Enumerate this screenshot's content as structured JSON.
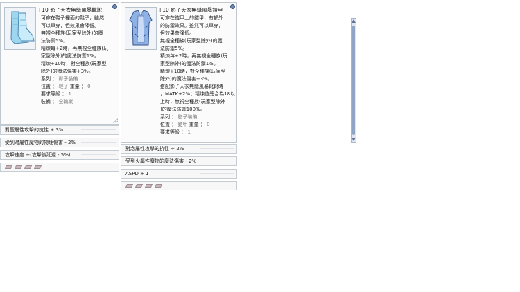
{
  "left": {
    "title": "+10 影子天衣無縫風暴靴靴",
    "image_icon": "blue-boots-icon",
    "lines": [
      "可穿在鞋子裡面的鞋子，雖然",
      "可以單穿，但效果會降低。",
      "無視全種族(玩家型除外)的魔",
      "法防禦5%。",
      "精煉每+2時，再無視全種族(玩",
      "家型除外)的魔法防禦1%。",
      "精煉+10時，對全種族(玩家型",
      "除外)的魔法傷害+3%。"
    ],
    "props": [
      {
        "label": "系列",
        "value": "影子裝備"
      },
      {
        "label": "位置",
        "value": "鞋子",
        "label2": "重量",
        "value2": "0"
      },
      {
        "label": "要求等級",
        "value": "1"
      },
      {
        "label": "裝備",
        "value": "全職業"
      }
    ],
    "bars": [
      "對聖屬性攻擊的抗性 + 3%",
      "受到暗屬性魔物的物理傷害 - 2%",
      "攻擊速度 +(攻擊後延遲 - 5%)"
    ]
  },
  "right": {
    "title": "+10 影子天衣無縫風暴鎧甲",
    "image_icon": "blue-armor-icon",
    "lines": [
      "可穿在鎧甲上的鎧甲，有額外",
      "的防禦效果。雖然可以單穿，",
      "但效果會降低。",
      "無視全種族(玩家型除外)的魔",
      "法防禦5%。",
      "精煉每+2時，再無視全種族(玩",
      "家型除外)的魔法防禦1%。",
      "精煉+10時，對全種族(玩家型",
      "除外)的魔法傷害+3%。",
      "搭配影子天衣無縫風暴靴靴時",
      "，MATK+2%；精煉值總合為18以",
      "上時，無視全種族(玩家型除外",
      ")的魔法防禦100%。"
    ],
    "props": [
      {
        "label": "系列",
        "value": "影子裝備"
      },
      {
        "label": "位置",
        "value": "鎧甲",
        "label2": "重量",
        "value2": "0"
      },
      {
        "label": "要求等級",
        "value": "1"
      }
    ],
    "bars": [
      "對念屬性攻擊的抗性 + 2%",
      "受到火屬性魔物的魔法傷害 - 2%",
      "ASPD + 1"
    ]
  }
}
